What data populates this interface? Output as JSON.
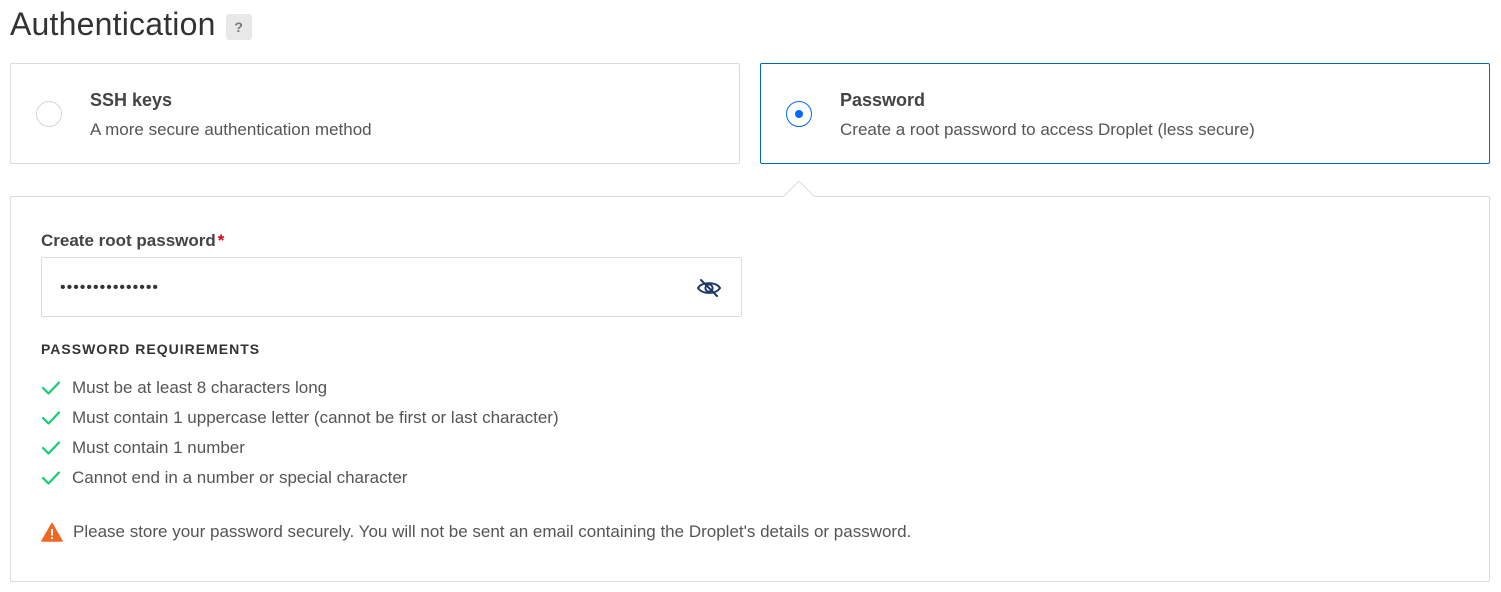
{
  "section": {
    "title": "Authentication",
    "help": "?"
  },
  "options": [
    {
      "title": "SSH keys",
      "description": "A more secure authentication method",
      "selected": false
    },
    {
      "title": "Password",
      "description": "Create a root password to access Droplet (less secure)",
      "selected": true
    }
  ],
  "password_field": {
    "label": "Create root password",
    "required_marker": "*",
    "value": "•••••••••••••••"
  },
  "requirements": {
    "heading": "PASSWORD REQUIREMENTS",
    "items": [
      "Must be at least 8 characters long",
      "Must contain 1 uppercase letter (cannot be first or last character)",
      "Must contain 1 number",
      "Cannot end in a number or special character"
    ],
    "check_color": "#15cd72"
  },
  "warning": {
    "text": "Please store your password securely. You will not be sent an email containing the Droplet's details or password.",
    "icon_color": "#f26622"
  },
  "colors": {
    "accent": "#0069ff",
    "selected_border": "#0069b3"
  }
}
